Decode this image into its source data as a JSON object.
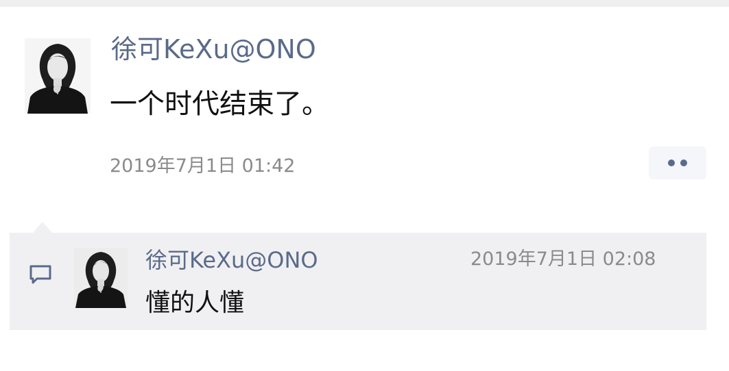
{
  "post": {
    "author": "徐可KeXu@ONO",
    "text": "一个时代结束了。",
    "timestamp": "2019年7月1日 01:42",
    "avatar_icon": "user-avatar-photo",
    "more_icon": "more-dots-icon"
  },
  "comment": {
    "icon": "comment-icon",
    "author": "徐可KeXu@ONO",
    "timestamp": "2019年7月1日 02:08",
    "text": "懂的人懂",
    "avatar_icon": "user-avatar-photo"
  },
  "colors": {
    "name_link": "#5a6a8a",
    "timestamp": "#8a8a8a",
    "comment_background": "#f0f0f2"
  }
}
